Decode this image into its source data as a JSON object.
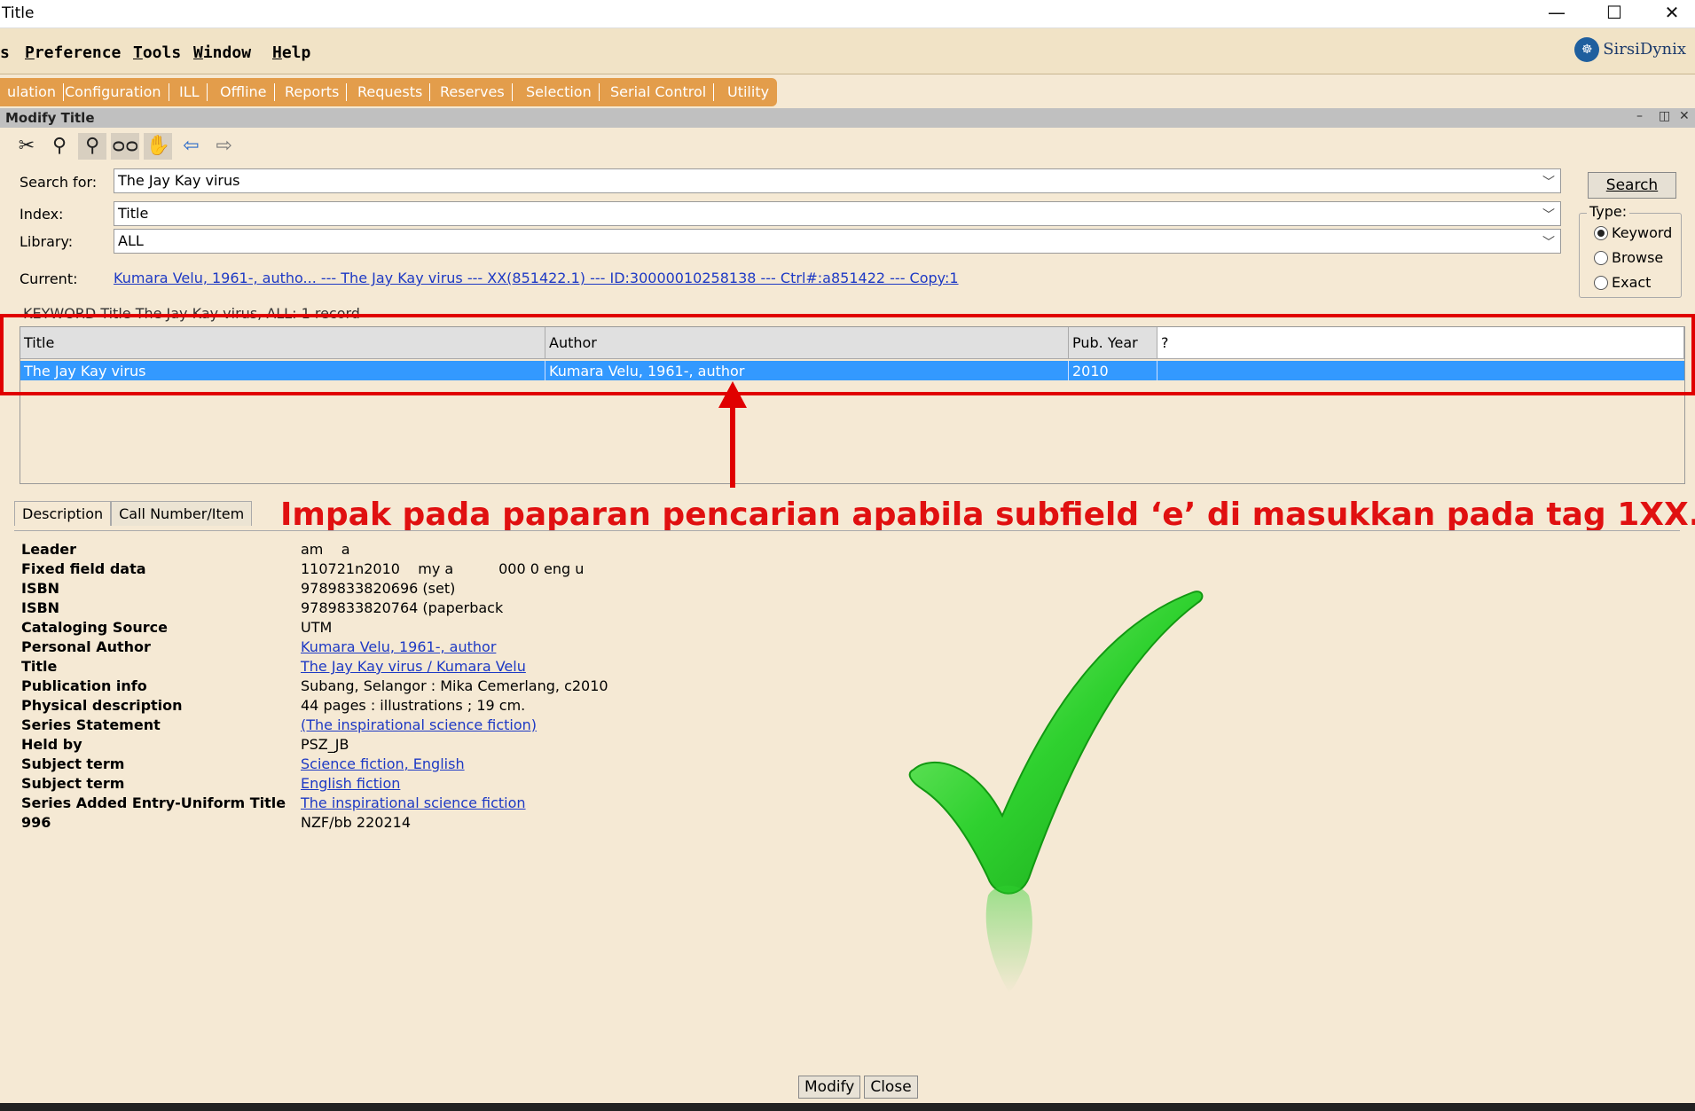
{
  "window": {
    "title": "Title",
    "minimize": "—",
    "maximize": "☐",
    "close": "✕"
  },
  "menubar": {
    "items": [
      {
        "label": "s",
        "key": ""
      },
      {
        "label": "Preference",
        "key": "P"
      },
      {
        "label": "Tools",
        "key": "T"
      },
      {
        "label": "Window",
        "key": "W"
      },
      {
        "label": "Help",
        "key": "H"
      }
    ],
    "brand": "SirsiDynix"
  },
  "tabs": [
    "ulation",
    "Configuration",
    "ILL",
    "Offline",
    "Reports",
    "Requests",
    "Reserves",
    "Selection",
    "Serial Control",
    "Utility"
  ],
  "subwindow": {
    "title": "Modify Title"
  },
  "search": {
    "search_for_label": "Search for:",
    "search_for_value": "The Jay Kay virus",
    "index_label": "Index:",
    "index_value": "Title",
    "library_label": "Library:",
    "library_value": "ALL",
    "current_label": "Current:",
    "current_value": "Kumara Velu, 1961-, autho... --- The Jay Kay virus --- XX(851422.1) --- ID:30000010258138 --- Ctrl#:a851422 --- Copy:1",
    "search_button": "Search",
    "type_label": "Type:",
    "type_options": [
      "Keyword",
      "Browse",
      "Exact"
    ],
    "type_selected": "Keyword"
  },
  "results": {
    "summary": "KEYWORD Title The Jay Kay virus, ALL: 1 record",
    "columns": [
      "Title",
      "Author",
      "Pub. Year",
      "?"
    ],
    "rows": [
      {
        "title": "The Jay Kay virus",
        "author": "Kumara Velu, 1961-, author",
        "year": "2010",
        "extra": ""
      }
    ]
  },
  "annotation": "Impak pada paparan pencarian apabila subfield ‘e’ di masukkan pada tag 1XX.",
  "description_tabs": [
    "Description",
    "Call Number/Item"
  ],
  "description": [
    {
      "label": "Leader",
      "value": "am    a",
      "link": false
    },
    {
      "label": "Fixed field data",
      "value": "110721n2010    my a          000 0 eng u",
      "link": false
    },
    {
      "label": "ISBN",
      "value": "9789833820696 (set)",
      "link": false
    },
    {
      "label": "ISBN",
      "value": "9789833820764 (paperback",
      "link": false
    },
    {
      "label": "Cataloging Source",
      "value": "UTM",
      "link": false
    },
    {
      "label": "Personal Author",
      "value": "Kumara Velu, 1961-, author",
      "link": true
    },
    {
      "label": "Title",
      "value": "The Jay Kay virus / Kumara Velu",
      "link": true
    },
    {
      "label": "Publication info",
      "value": "Subang, Selangor : Mika Cemerlang, c2010",
      "link": false
    },
    {
      "label": "Physical description",
      "value": "44 pages : illustrations ; 19 cm.",
      "link": false
    },
    {
      "label": "Series Statement",
      "value": "(The inspirational science fiction)",
      "link": true
    },
    {
      "label": "Held by",
      "value": "PSZ_JB",
      "link": false
    },
    {
      "label": "Subject term",
      "value": "Science fiction, English",
      "link": true
    },
    {
      "label": "Subject term",
      "value": "English fiction",
      "link": true
    },
    {
      "label": "Series Added Entry-Uniform Title",
      "value": "The inspirational science fiction",
      "link": true
    },
    {
      "label": "996",
      "value": "NZF/bb 220214",
      "link": false
    }
  ],
  "buttons": {
    "modify": "Modify",
    "close": "Close"
  },
  "colors": {
    "accent_tab": "#e39d4b",
    "selection": "#3399ff",
    "annotation": "#e00000",
    "check": "#2ecc2e"
  }
}
